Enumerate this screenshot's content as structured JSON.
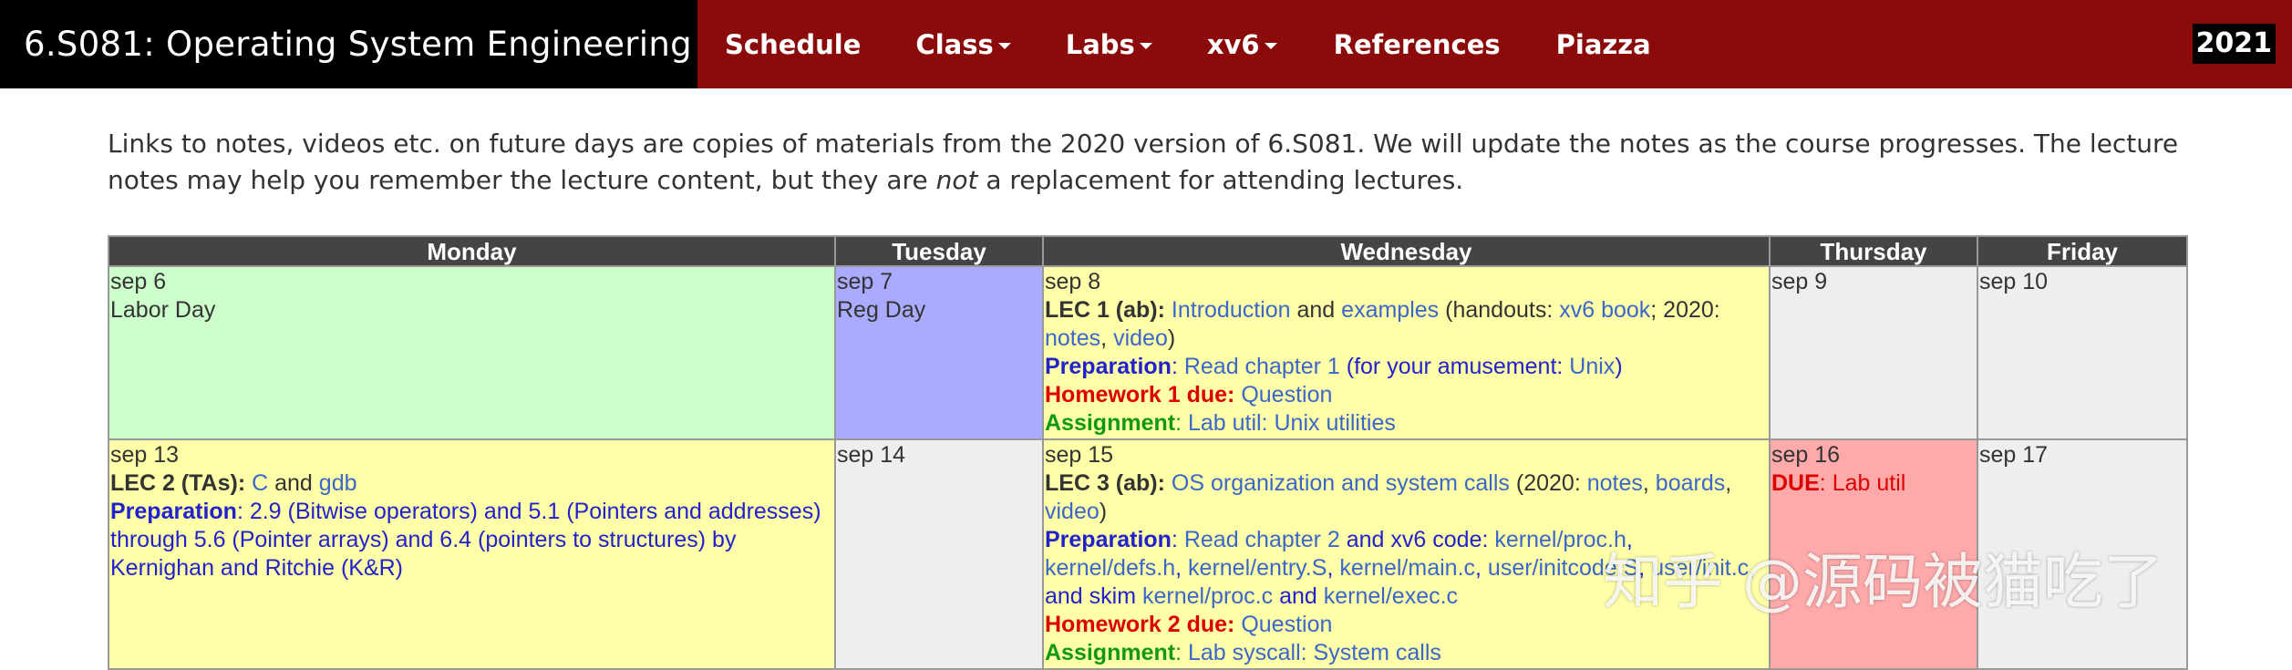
{
  "nav": {
    "brand": "6.S081: Operating System Engineering",
    "items": [
      {
        "label": "Schedule",
        "dropdown": false
      },
      {
        "label": "Class",
        "dropdown": true
      },
      {
        "label": "Labs",
        "dropdown": true
      },
      {
        "label": "xv6",
        "dropdown": true
      },
      {
        "label": "References",
        "dropdown": false
      },
      {
        "label": "Piazza",
        "dropdown": false
      }
    ],
    "year": "2021",
    "colors": {
      "bar": "#8b0a0a",
      "brand_bg": "#000000"
    }
  },
  "intro": {
    "part1": "Links to notes, videos etc. on future days are copies of materials from the 2020 version of 6.S081. We will update the notes as the course progresses. The lecture notes may help you remember the lecture content, but they are",
    "emph": "not",
    "part2": "a replacement for attending lectures."
  },
  "calendar": {
    "headers": [
      "Monday",
      "Tuesday",
      "Wednesday",
      "Thursday",
      "Friday"
    ],
    "sep6": {
      "date": "sep 6",
      "event": "Labor Day"
    },
    "sep7": {
      "date": "sep 7",
      "event": "Reg Day"
    },
    "sep8": {
      "date": "sep 8",
      "lec": "LEC 1 (ab):",
      "lec_link1": "Introduction",
      "and": "and",
      "lec_link2": "examples",
      "handouts_open": "(handouts:",
      "handouts_link": "xv6 book",
      "sep2020": "; 2020:",
      "notes": "notes",
      "comma": ",",
      "video": "video",
      "close": ")",
      "prep_label": "Preparation",
      "prep_colon": ":",
      "prep_link": "Read chapter 1",
      "prep_extra_open": "(for your amusement:",
      "prep_extra_link": "Unix",
      "prep_extra_close": ")",
      "hw_label": "Homework 1 due:",
      "hw_link": "Question",
      "assign_label": "Assignment",
      "assign_colon": ":",
      "assign_link": "Lab util: Unix utilities"
    },
    "sep9": {
      "date": "sep 9"
    },
    "sep10": {
      "date": "sep 10"
    },
    "sep13": {
      "date": "sep 13",
      "lec": "LEC 2 (TAs):",
      "link_c": "C",
      "and": "and",
      "link_gdb": "gdb",
      "prep_label": "Preparation",
      "prep_text": ": 2.9 (Bitwise operators) and 5.1 (Pointers and addresses) through 5.6 (Pointer arrays) and 6.4 (pointers to structures) by Kernighan and Ritchie (K&R)"
    },
    "sep14": {
      "date": "sep 14"
    },
    "sep15": {
      "date": "sep 15",
      "lec": "LEC 3 (ab):",
      "lec_link": "OS organization and system calls",
      "y2020_open": "(2020:",
      "notes": "notes",
      "comma": ",",
      "boards": "boards",
      "video": "video",
      "close": ")",
      "prep_label": "Preparation",
      "prep_colon": ":",
      "prep_link": "Read chapter 2",
      "prep_and_code": "and xv6 code:",
      "code1": "kernel/proc.h",
      "code2": "kernel/defs.h",
      "code3": "kernel/entry.S",
      "code4": "kernel/main.c",
      "code5": "user/initcode.S",
      "code6": "user/init.c",
      "and_skim": ", and skim",
      "code7": "kernel/proc.c",
      "and": "and",
      "code8": "kernel/exec.c",
      "hw_label": "Homework 2 due:",
      "hw_link": "Question",
      "assign_label": "Assignment",
      "assign_colon": ":",
      "assign_link": "Lab syscall: System calls"
    },
    "sep16": {
      "date": "sep 16",
      "due_label": "DUE",
      "due_text": ": Lab util"
    },
    "sep17": {
      "date": "sep 17"
    },
    "colors": {
      "holiday": "#ccffcc",
      "reg_day": "#aaaaff",
      "lecture": "#ffffaa",
      "empty": "#eeeeee",
      "due": "#ffaaaa",
      "header_bg": "#444444",
      "link": "#3b67c9"
    }
  },
  "watermark": "知乎 @源码被猫吃了"
}
